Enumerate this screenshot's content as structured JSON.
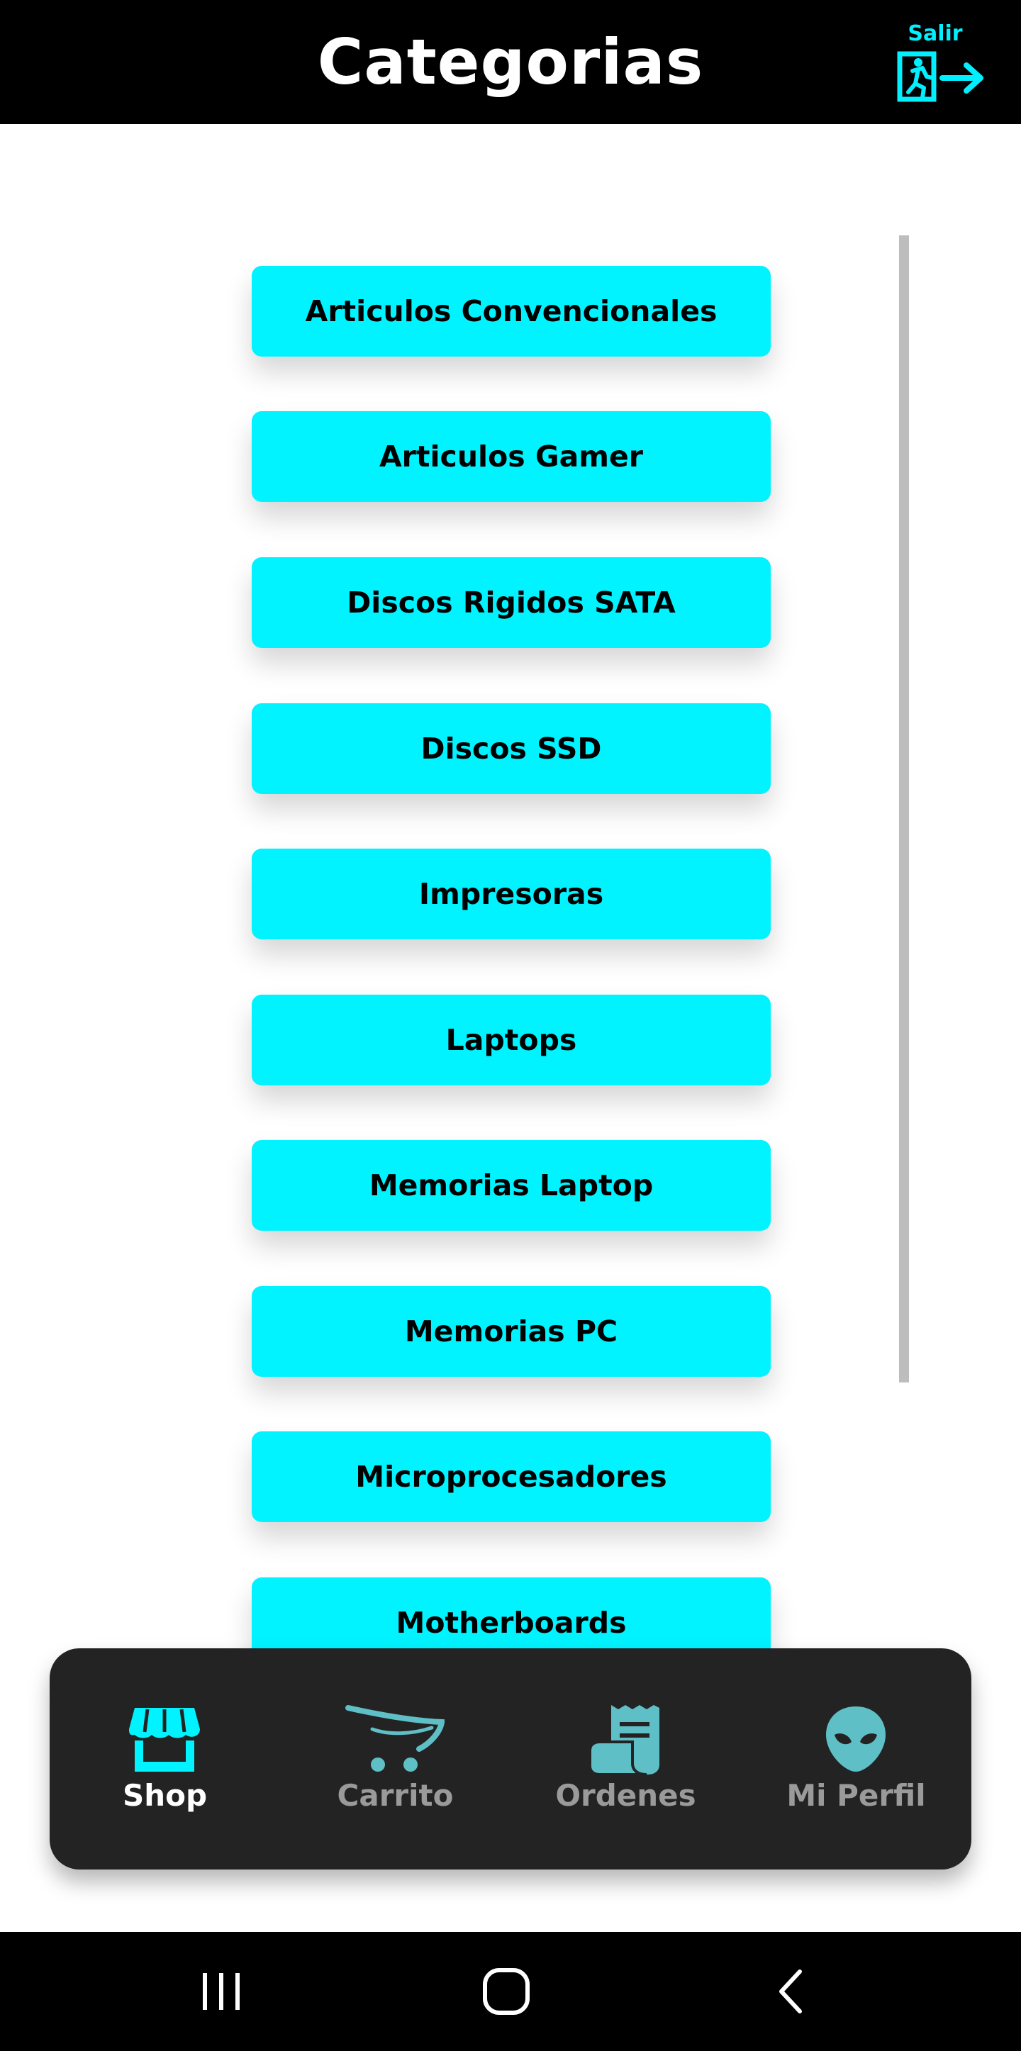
{
  "header": {
    "title": "Categorias",
    "logout_label": "Salir",
    "logout_icon": "exit-door-icon"
  },
  "categories": [
    {
      "label": "Articulos Convencionales"
    },
    {
      "label": "Articulos Gamer"
    },
    {
      "label": "Discos Rigidos SATA"
    },
    {
      "label": "Discos SSD"
    },
    {
      "label": "Impresoras"
    },
    {
      "label": "Laptops"
    },
    {
      "label": "Memorias Laptop"
    },
    {
      "label": "Memorias PC"
    },
    {
      "label": "Microprocesadores"
    },
    {
      "label": "Motherboards"
    }
  ],
  "bottom_nav": {
    "items": [
      {
        "label": "Shop",
        "icon": "store-icon",
        "active": true
      },
      {
        "label": "Carrito",
        "icon": "cart-icon",
        "active": false
      },
      {
        "label": "Ordenes",
        "icon": "receipt-icon",
        "active": false
      },
      {
        "label": "Mi Perfil",
        "icon": "alien-icon",
        "active": false
      }
    ]
  },
  "system_nav": {
    "buttons": [
      "recent-apps-icon",
      "home-icon",
      "back-icon"
    ]
  },
  "colors": {
    "accent": "#00f3ff",
    "header_bg": "#000000",
    "nav_bg": "#232323",
    "nav_active": "#ffffff",
    "nav_inactive": "#9a9a9a",
    "nav_icon_inactive": "#5fbfc6"
  }
}
